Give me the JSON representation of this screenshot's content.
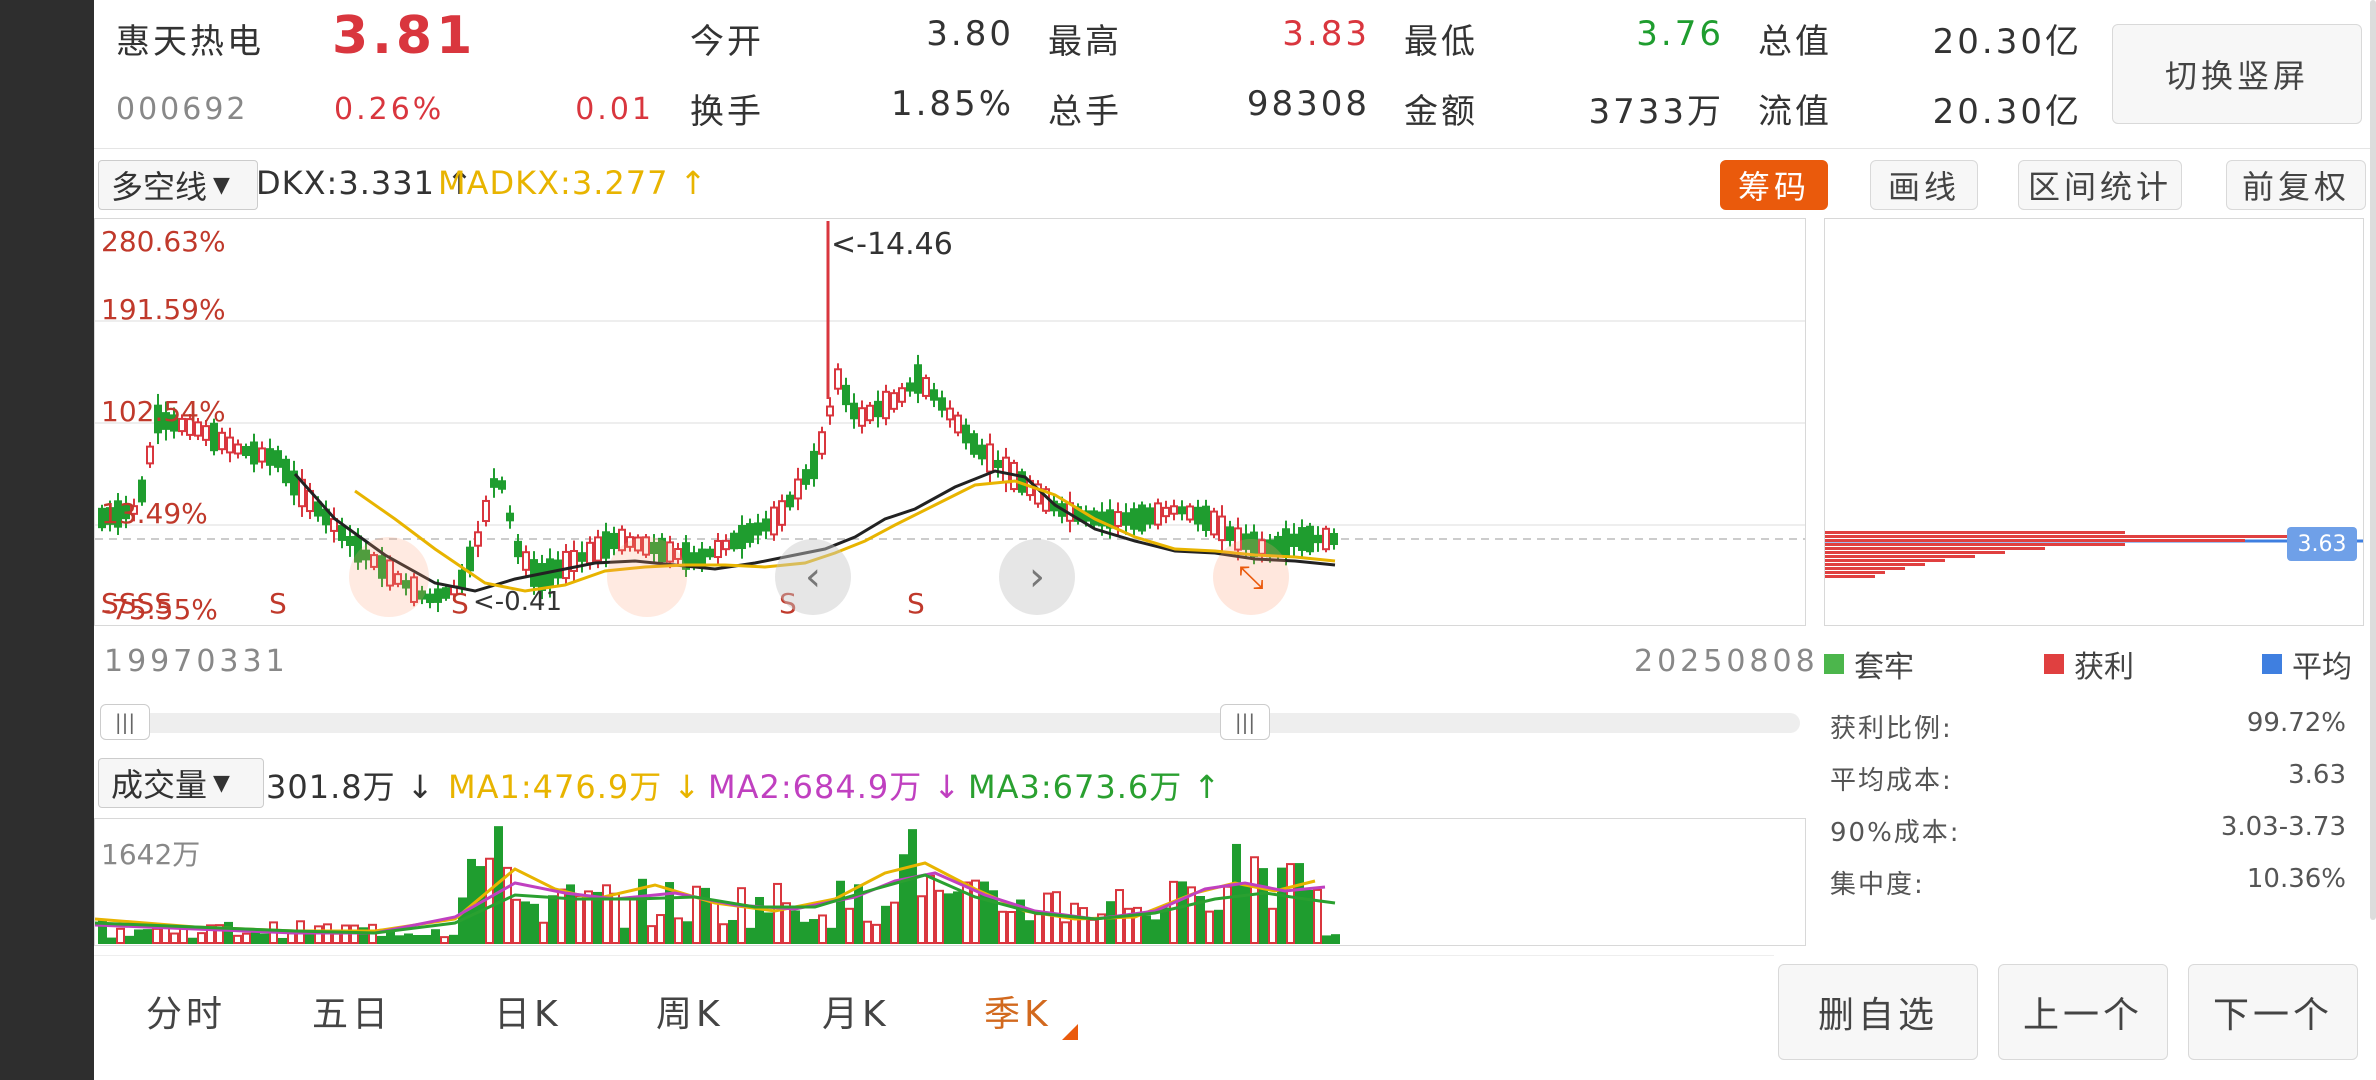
{
  "header": {
    "stock_name": "惠天热电",
    "price": "3.81",
    "code": "000692",
    "change_pct": "0.26%",
    "change_amt": "0.01",
    "fields": [
      {
        "label": "今开",
        "value": "3.80",
        "color": "#333333"
      },
      {
        "label": "最高",
        "value": "3.83",
        "color": "#d9363e"
      },
      {
        "label": "最低",
        "value": "3.76",
        "color": "#1f9d2f"
      },
      {
        "label": "总值",
        "value": "20.30亿",
        "color": "#333333"
      },
      {
        "label": "换手",
        "value": "1.85%",
        "color": "#333333"
      },
      {
        "label": "总手",
        "value": "98308",
        "color": "#333333"
      },
      {
        "label": "金额",
        "value": "3733万",
        "color": "#333333"
      },
      {
        "label": "流值",
        "value": "20.30亿",
        "color": "#333333"
      }
    ],
    "switch_button": "切换竖屏"
  },
  "indicator_bar": {
    "selector": "多空线",
    "dkx": "DKX:3.331 ↑",
    "madkx": "MADKX:3.277 ↑",
    "buttons": [
      "筹码",
      "画线",
      "区间统计",
      "前复权"
    ]
  },
  "main_chart": {
    "y_labels": [
      "280.63%",
      "191.59%",
      "102.54%",
      "13.49%",
      "-75.55%"
    ],
    "high_marker": "<-14.46",
    "low_marker": "<-0.41",
    "sell_marks": [
      "SSSS",
      "S",
      "S",
      "S",
      "S"
    ],
    "start_date": "19970331",
    "end_date": "20250808",
    "nav_prev_icon": "chevron-left-icon",
    "nav_next_icon": "chevron-right-icon",
    "expand_icon": "expand-arrows-icon"
  },
  "volume": {
    "selector": "成交量",
    "vol": "301.8万 ↓",
    "ma1": "MA1:476.9万 ↓",
    "ma2": "MA2:684.9万 ↓",
    "ma3": "MA3:673.6万 ↑",
    "max_label": "1642万"
  },
  "chip": {
    "price_tag": "3.63",
    "legend": [
      "套牢",
      "获利",
      "平均"
    ],
    "stats": [
      {
        "label": "获利比例:",
        "value": "99.72%"
      },
      {
        "label": "平均成本:",
        "value": "3.63"
      },
      {
        "label": "90%成本:",
        "value": "3.03-3.73"
      },
      {
        "label": "集中度:",
        "value": "10.36%"
      }
    ]
  },
  "bottom_tabs": [
    "分时",
    "五日",
    "日K",
    "周K",
    "月K",
    "季K"
  ],
  "active_tab": "季K",
  "bottom_buttons": [
    "删自选",
    "上一个",
    "下一个"
  ],
  "colors": {
    "up": "#d9363e",
    "down": "#1f9d2f",
    "accent": "#ea5a0c",
    "dkx_line": "#222222",
    "madkx_line": "#e8b400",
    "ma1": "#e8b400",
    "ma2": "#c040c0",
    "ma3": "#2aa030"
  }
}
